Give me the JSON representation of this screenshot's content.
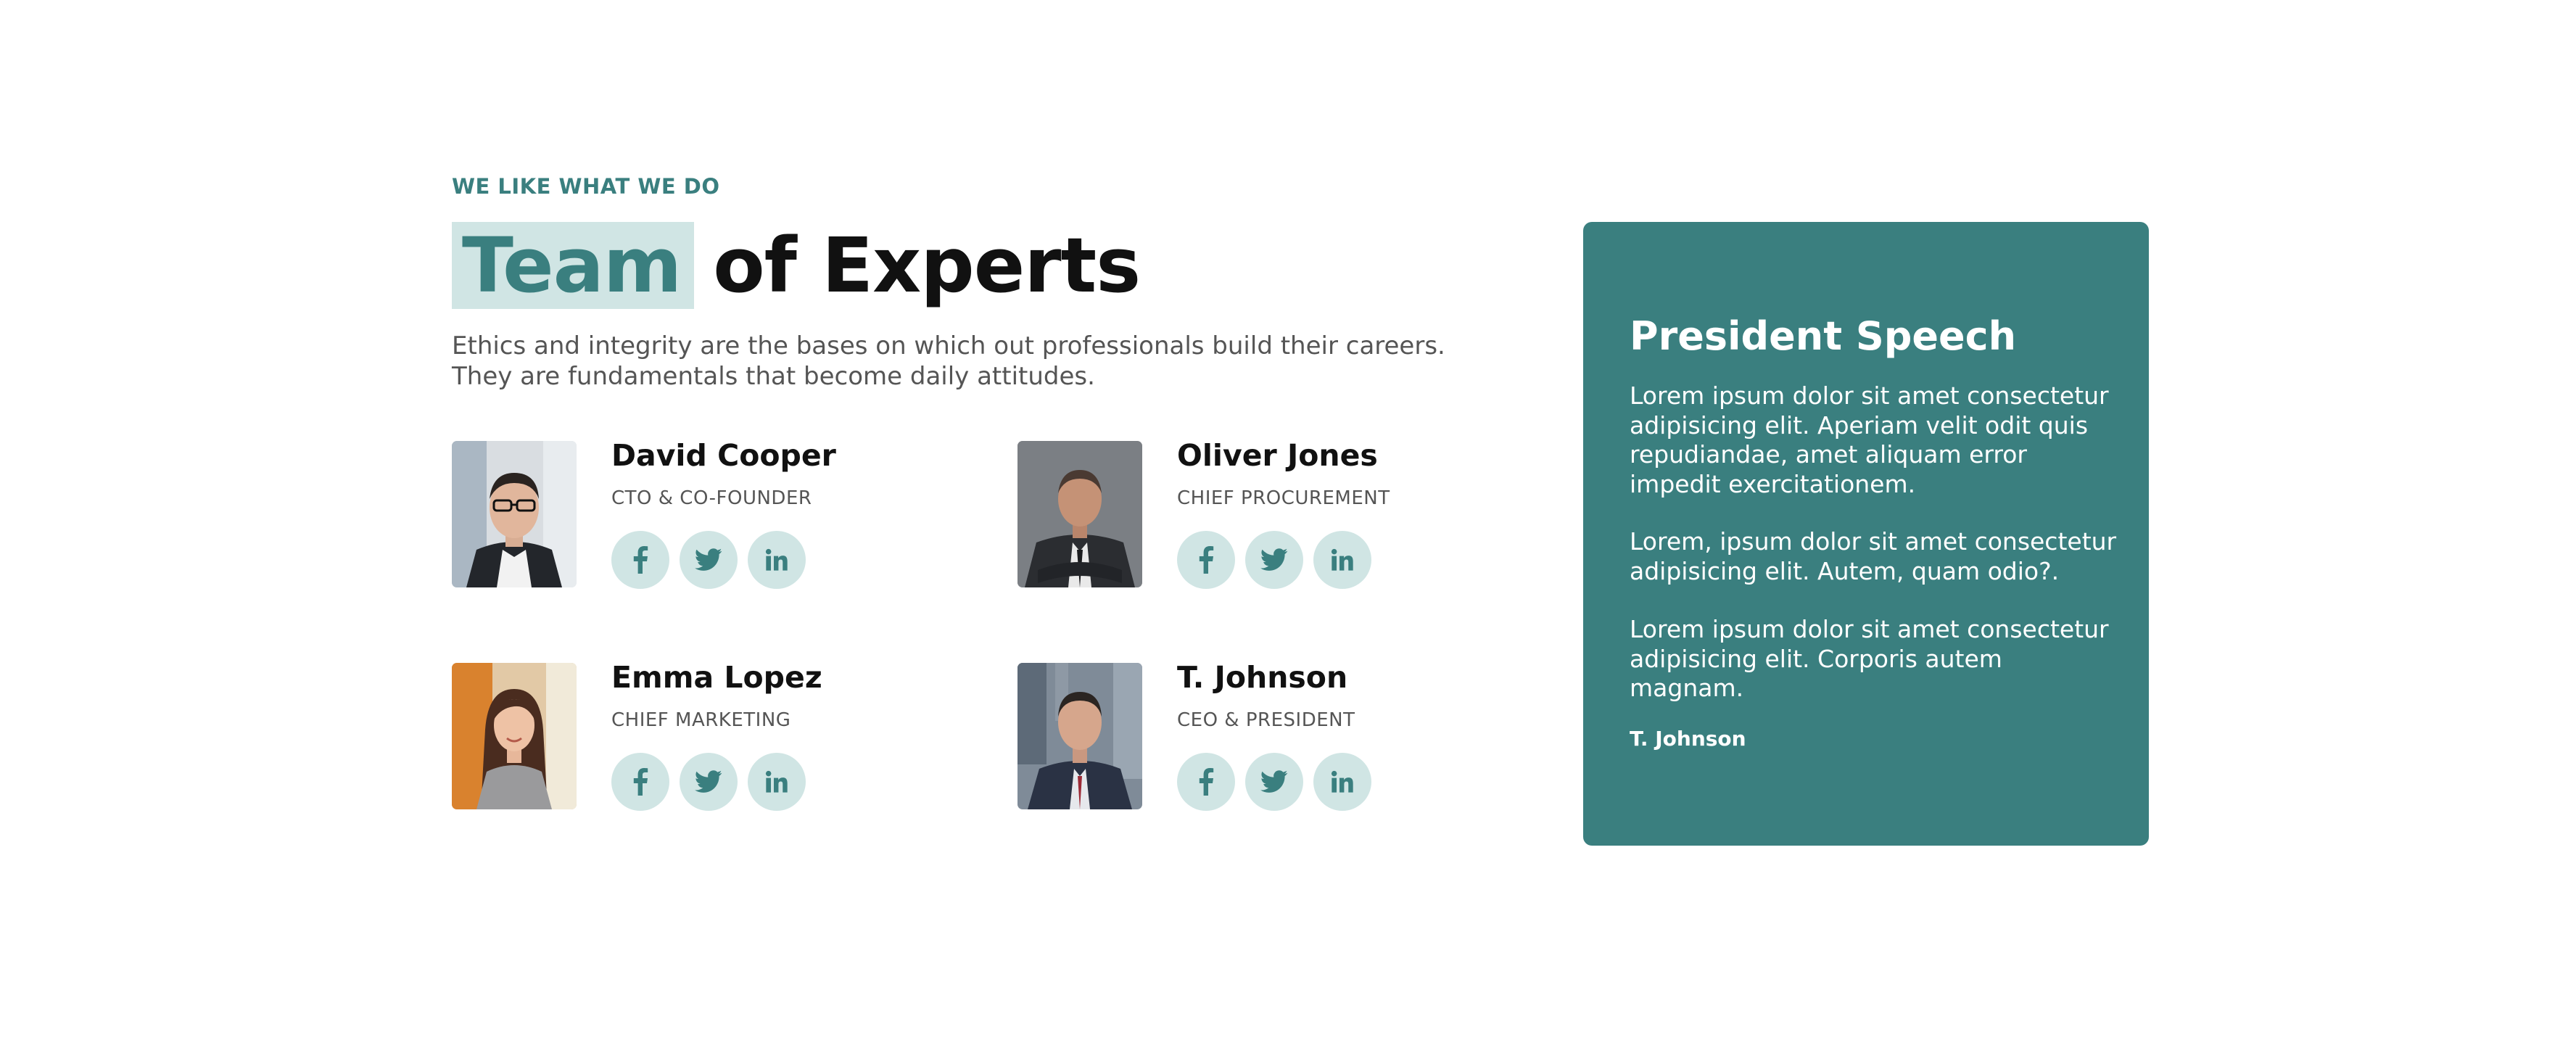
{
  "section": {
    "eyebrow": "WE LIKE WHAT WE DO",
    "title_highlight": "Team",
    "title_rest": "of Experts",
    "intro_line_1": "Ethics and integrity are the bases on which out professionals build their careers.",
    "intro_line_2": "They are fundamentals that become daily attitudes."
  },
  "team": [
    {
      "name": "David Cooper",
      "role": "CTO & CO-FOUNDER",
      "photo_icon": "person-photo",
      "socials": [
        "facebook-icon",
        "twitter-icon",
        "linkedin-icon"
      ]
    },
    {
      "name": "Oliver Jones",
      "role": "CHIEF PROCUREMENT",
      "photo_icon": "person-photo",
      "socials": [
        "facebook-icon",
        "twitter-icon",
        "linkedin-icon"
      ]
    },
    {
      "name": "Emma Lopez",
      "role": "CHIEF MARKETING",
      "photo_icon": "person-photo",
      "socials": [
        "facebook-icon",
        "twitter-icon",
        "linkedin-icon"
      ]
    },
    {
      "name": "T. Johnson",
      "role": "CEO & PRESIDENT",
      "photo_icon": "person-photo",
      "socials": [
        "facebook-icon",
        "twitter-icon",
        "linkedin-icon"
      ]
    }
  ],
  "speech": {
    "title": "President Speech",
    "p1": [
      "Lorem ipsum dolor sit amet consectetur",
      "adipisicing elit. Aperiam velit odit quis",
      "repudiandae, amet aliquam error",
      "impedit exercitationem."
    ],
    "p2": [
      "Lorem, ipsum dolor sit amet consectetur",
      "adipisicing elit. Autem, quam odio?."
    ],
    "p3": [
      "Lorem ipsum dolor sit amet consectetur",
      "adipisicing elit. Corporis autem",
      "magnam."
    ],
    "signature": "T. Johnson"
  },
  "colors": {
    "accent": "#3a7f7f",
    "accent_light": "#d0e5e4",
    "heading": "#111111",
    "body_text": "#555555",
    "background": "#ffffff"
  }
}
